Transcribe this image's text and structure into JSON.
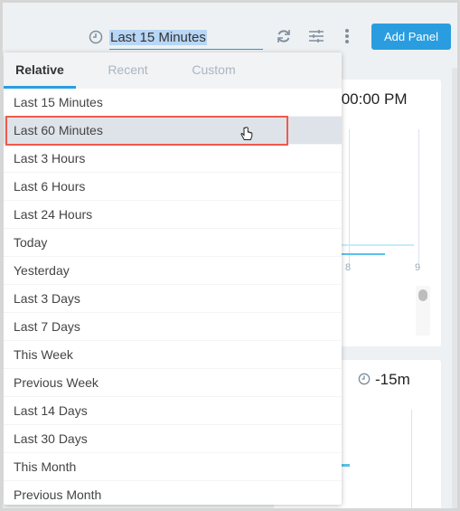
{
  "toolbar": {
    "time_range": "Last 15 Minutes",
    "add_panel": "Add Panel"
  },
  "picker": {
    "tabs": [
      "Relative",
      "Recent",
      "Custom"
    ],
    "active_tab": "Relative",
    "items": [
      "Last 15 Minutes",
      "Last 60 Minutes",
      "Last 3 Hours",
      "Last 6 Hours",
      "Last 24 Hours",
      "Today",
      "Yesterday",
      "Last 3 Days",
      "Last 7 Days",
      "This Week",
      "Previous Week",
      "Last 14 Days",
      "Last 30 Days",
      "This Month",
      "Previous Month"
    ],
    "hovered": "Last 60 Minutes"
  },
  "panels": [
    {
      "title_fragment": ":00:00 PM",
      "axis_ticks": [
        "8",
        "9"
      ]
    },
    {
      "time": "-15m"
    }
  ],
  "colors": {
    "accent": "#2a9de0",
    "highlight": "#f05a4c"
  }
}
